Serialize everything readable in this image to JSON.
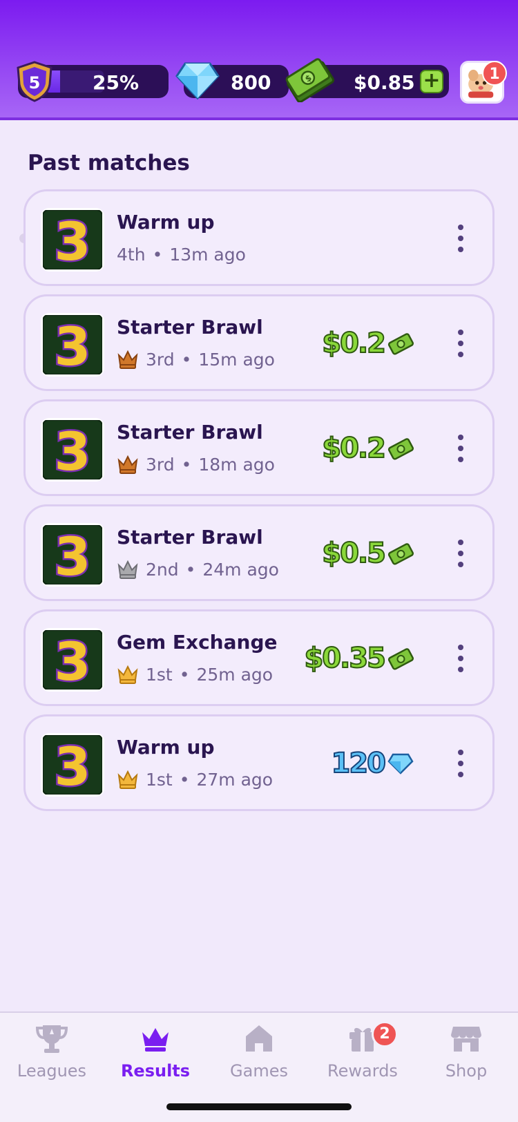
{
  "header": {
    "level": "5",
    "level_progress_label": "25%",
    "level_progress_fraction": 0.25,
    "gems": "800",
    "cash": "$0.85",
    "add_funds_label": "+",
    "notifications_count": "1",
    "icons": {
      "level": "shield-icon",
      "gems": "gem-icon",
      "cash": "cash-stack-icon",
      "avatar": "profile-avatar"
    }
  },
  "section_title": "Past matches",
  "matches": [
    {
      "title": "Warm up",
      "place": "4th",
      "sep": "•",
      "time": "13m ago",
      "crown": "none",
      "prize": "",
      "prize_type": "none"
    },
    {
      "title": "Starter Brawl",
      "place": "3rd",
      "sep": "•",
      "time": "15m ago",
      "crown": "bronze",
      "prize": "$0.2",
      "prize_type": "cash"
    },
    {
      "title": "Starter Brawl",
      "place": "3rd",
      "sep": "•",
      "time": "18m ago",
      "crown": "bronze",
      "prize": "$0.2",
      "prize_type": "cash"
    },
    {
      "title": "Starter Brawl",
      "place": "2nd",
      "sep": "•",
      "time": "24m ago",
      "crown": "silver",
      "prize": "$0.5",
      "prize_type": "cash"
    },
    {
      "title": "Gem Exchange",
      "place": "1st",
      "sep": "•",
      "time": "25m ago",
      "crown": "gold",
      "prize": "$0.35",
      "prize_type": "cash"
    },
    {
      "title": "Warm up",
      "place": "1st",
      "sep": "•",
      "time": "27m ago",
      "crown": "gold",
      "prize": "120",
      "prize_type": "gem"
    }
  ],
  "nav": {
    "items": [
      {
        "label": "Leagues",
        "icon": "trophy-icon"
      },
      {
        "label": "Results",
        "icon": "crown-icon",
        "active": true
      },
      {
        "label": "Games",
        "icon": "home-icon"
      },
      {
        "label": "Rewards",
        "icon": "gift-icon",
        "badge": "2"
      },
      {
        "label": "Shop",
        "icon": "store-icon"
      }
    ]
  },
  "colors": {
    "header_top": "#7c1bf0",
    "accent": "#7a1ef0",
    "cash_green": "#8bd83a",
    "gem_blue": "#5cc1f6",
    "badge_red": "#f05353"
  }
}
